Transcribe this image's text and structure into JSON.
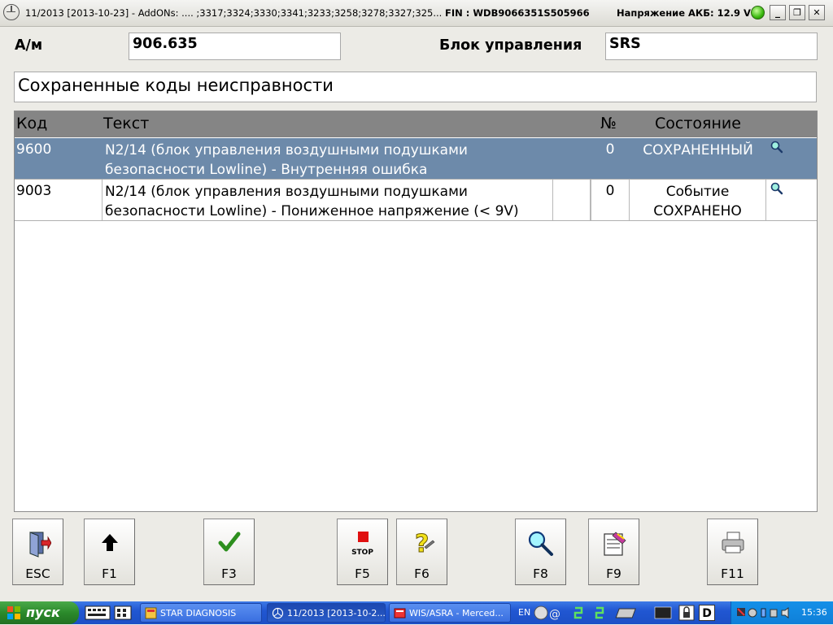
{
  "titlebar": {
    "version": "11/2013 [2013-10-23] - AddONs:  .... ;3317;3324;3330;3341;3233;3258;3278;3327;325...",
    "fin": "FIN : WDB9066351S505966",
    "battery": "Напряжение АКБ: 12.9 V",
    "minimize": "_",
    "restore": "❐",
    "close": "✕"
  },
  "header": {
    "vehicle_label": "А/м",
    "vehicle_value": "906.635",
    "ecu_label": "Блок управления",
    "ecu_value": "SRS"
  },
  "section_title": "Сохраненные коды неисправности",
  "table": {
    "columns": {
      "code": "Код",
      "text": "Текст",
      "no": "№",
      "state": "Состояние"
    },
    "rows": [
      {
        "code": "9600",
        "text_line1": "N2/14 (блок управления воздушными подушками",
        "text_line2": "безопасности Lowline) - Внутренняя ошибка",
        "no": "0",
        "state_line1": "СОХРАНЕННЫЙ",
        "state_line2": "",
        "selected": true,
        "icon": "magnifier-icon"
      },
      {
        "code": "9003",
        "text_line1": "N2/14 (блок управления воздушными подушками",
        "text_line2": "безопасности Lowline) - Пониженное напряжение (< 9V)",
        "no": "0",
        "state_line1": "Событие",
        "state_line2": "СОХРАНЕНО",
        "selected": false,
        "icon": "magnifier-icon"
      }
    ]
  },
  "fkeys": {
    "esc": "ESC",
    "f1": "F1",
    "f3": "F3",
    "f5": "F5",
    "f5_stop": "STOP",
    "f6": "F6",
    "f8": "F8",
    "f9": "F9",
    "f11": "F11"
  },
  "taskbar": {
    "start": "пуск",
    "tasks": [
      "STAR DIAGNOSIS",
      "11/2013 [2013-10-2...",
      "WIS/ASRA - Merced..."
    ],
    "lang": "EN",
    "tray_d": "D",
    "clock": "15:36"
  },
  "colors": {
    "selected_row": "#6d8aaa",
    "header_row": "#858585",
    "background": "#ecebe6",
    "taskbar": "#2157d2",
    "start": "#2b8a2b"
  }
}
